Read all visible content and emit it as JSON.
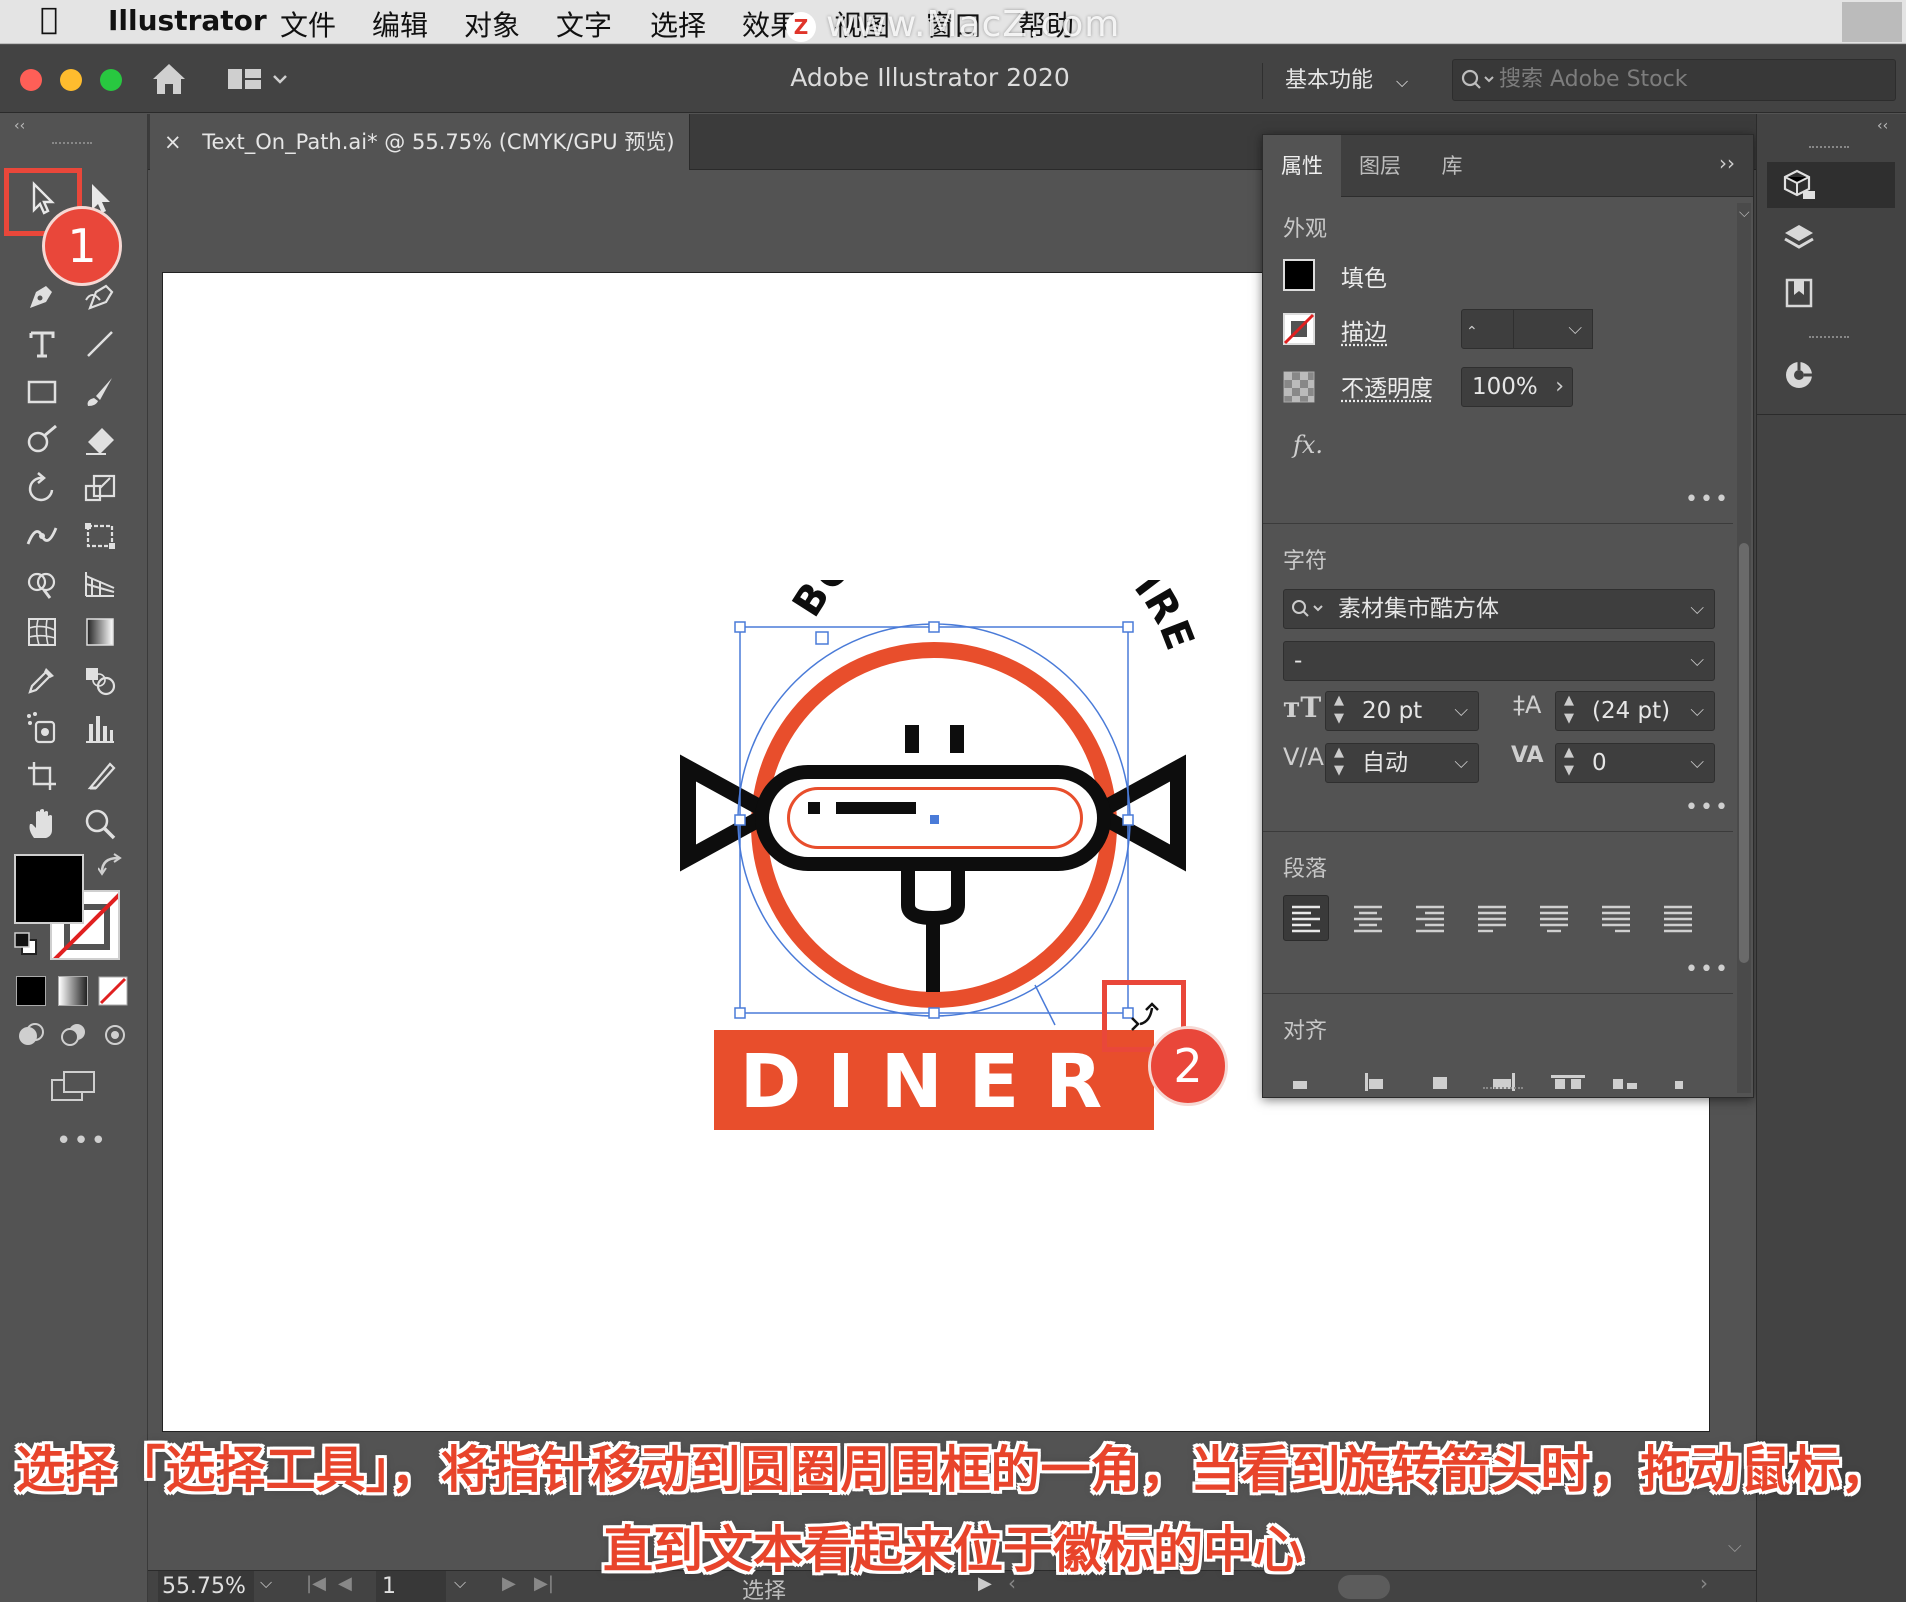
{
  "menubar": {
    "app_name": "Illustrator",
    "items": [
      "文件",
      "编辑",
      "对象",
      "文字",
      "选择",
      "效果",
      "视图",
      "窗口",
      "帮助"
    ],
    "watermark": "www.MacZ.com",
    "watermark_badge": "Z"
  },
  "titlebar": {
    "title": "Adobe Illustrator 2020",
    "workspace": "基本功能",
    "search_placeholder": "搜索 Adobe Stock"
  },
  "document": {
    "tab_label": "Text_On_Path.ai* @ 55.75% (CMYK/GPU 预览)",
    "close_glyph": "×"
  },
  "artwork": {
    "arc_text": "BOBBY'S CAMPFIRE",
    "banner_text": "DINER",
    "colors": {
      "orange": "#e84e2c",
      "black": "#0d0d0d",
      "selection": "#4a7bd8"
    }
  },
  "properties_panel": {
    "tabs": [
      "属性",
      "图层",
      "库"
    ],
    "active_tab": "属性",
    "appearance": {
      "title": "外观",
      "fill_label": "填色",
      "stroke_label": "描边",
      "opacity_label": "不透明度",
      "opacity_value": "100%",
      "fx_label": "fx."
    },
    "character": {
      "title": "字符",
      "font_family": "素材集市酷方体",
      "font_style": "-",
      "font_size": "20 pt",
      "leading": "(24 pt)",
      "kerning": "自动",
      "tracking": "0"
    },
    "paragraph": {
      "title": "段落"
    },
    "align": {
      "title": "对齐"
    }
  },
  "statusbar": {
    "zoom": "55.75%",
    "artboard_number": "1",
    "current_tool": "选择"
  },
  "annotations": {
    "step1": "1",
    "step2": "2",
    "caption_line1": "选择「选择工具」，将指针移动到圆圈周围框的一角，当看到旋转箭头时，拖动鼠标，",
    "caption_line2": "直到文本看起来位于徽标的中心"
  }
}
